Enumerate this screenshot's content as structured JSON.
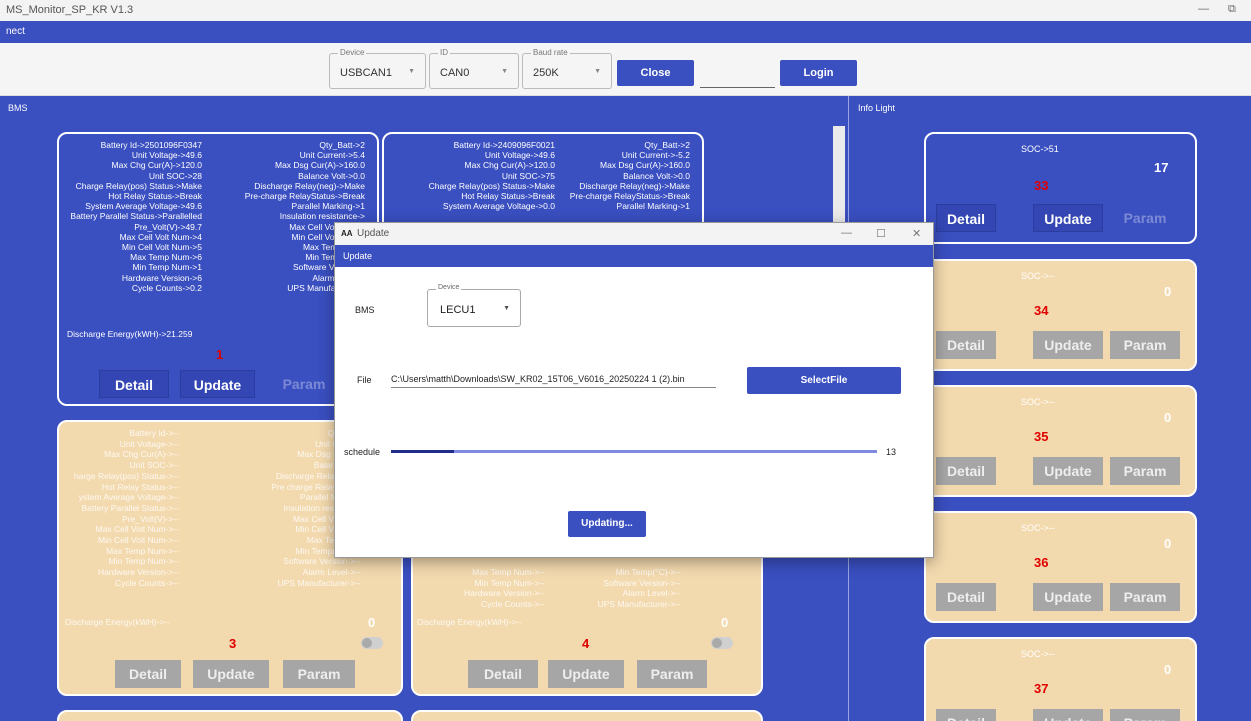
{
  "app": {
    "title": "MS_Monitor_SP_KR V1.3",
    "menu": "nect",
    "minimize_glyph": "—",
    "restore_glyph": "⧉"
  },
  "toolbar": {
    "device": {
      "label": "Device",
      "value": "USBCAN1"
    },
    "id": {
      "label": "ID",
      "value": "CAN0"
    },
    "baud": {
      "label": "Baud rate",
      "value": "250K"
    },
    "close_label": "Close",
    "login_label": "Login"
  },
  "sections": {
    "bms": "BMS",
    "info_light": "Info Light"
  },
  "card1": {
    "left": [
      "Battery Id->2501096F0347",
      "Unit Voltage->49.6",
      "Max Chg Cur(A)->120.0",
      "Unit SOC->28",
      "Charge Relay(pos) Status->Make",
      "Hot Relay Status->Break",
      "System Average Voltage->49.6",
      "Battery Parallel Status->Parallelled",
      "Pre_Volt(V)->49.7",
      "Max Cell Volt Num->4",
      "Min Cell Volt Num->5",
      "Max Temp Num->6",
      "Min Temp Num->1",
      "Hardware Version->6",
      "Cycle Counts->0.2",
      "Discharge Energy(kWH)->21.259"
    ],
    "right": [
      "Qty_Batt->2",
      "Unit Current->5.4",
      "Max Dsg Cur(A)->160.0",
      "Balance Volt->0.0",
      "Discharge Relay(neg)->Make",
      "Pre-charge RelayStatus->Break",
      "Parallel Marking->1",
      "Insulation resistance->",
      "Max Cell Volt(mV)->",
      "Min Cell Volt(mV)->",
      "Max Temp(°C)->",
      "Min Temp(°C)->",
      "Software Version->",
      "Alarm Level->",
      "UPS Manufacturer->"
    ],
    "num": "1",
    "detail": "Detail",
    "update": "Update",
    "param": "Param"
  },
  "card2": {
    "left": [
      "Battery Id->2409096F0021",
      "Unit Voltage->49.6",
      "Max Chg Cur(A)->120.0",
      "Unit SOC->75",
      "Charge Relay(pos) Status->Make",
      "Hot Relay Status->Break",
      "System Average Voltage->0.0"
    ],
    "right": [
      "Qty_Batt->2",
      "Unit Current->-5.2",
      "Max Dsg Cur(A)->160.0",
      "Balance Volt->0.0",
      "Discharge Relay(neg)->Make",
      "Pre-charge RelayStatus->Break",
      "Parallel Marking->1"
    ]
  },
  "card3": {
    "left": [
      "Battery Id->--",
      "Unit Voltage->--",
      "Max Chg Cur(A)->--",
      "Unit SOC->--",
      "harge Relay(pos) Status->--",
      "Hot Relay Status->--",
      "ystem Average Voltage->--",
      "Battery Parallel Status->--",
      "Pre_Volt(V)->--",
      "Max Cell Volt Num->--",
      "Min Cell Volt Num->--",
      "Max Temp Num->--",
      "Min Temp Num->--",
      "Hardware Version->--",
      "Cycle Counts->--",
      "Discharge Energy(kWH)->--"
    ],
    "right": [
      "Qty_Batt",
      "Unit Current",
      "Max Dsg Cur(A)-",
      "Balance Volt",
      "Discharge Relay(neg)-",
      "Pre charge RelayStatus",
      "Parallel Marking",
      "Insulation resistance",
      "Max Cell Volt(mV)",
      "Min Cell Volt(mV)",
      "Max Temp(°C)",
      "Min Temp(°C)->--",
      "Software Version->--",
      "Alarm Level->--",
      "UPS Manufacturer->--"
    ],
    "zero": "0",
    "num": "3",
    "detail": "Detail",
    "update": "Update",
    "param": "Param"
  },
  "card4": {
    "left": [
      "Max Temp Num->--",
      "Min Temp Num->--",
      "Hardware Version->--",
      "Cycle Counts->--",
      "Discharge Energy(kWH)->--"
    ],
    "right": [
      "Min Temp(°C)->--",
      "Software Version->--",
      "Alarm Level->--",
      "UPS Manufacturer->--"
    ],
    "zero": "0",
    "num": "4",
    "detail": "Detail",
    "update": "Update",
    "param": "Param"
  },
  "right_cards": [
    {
      "soc": "SOC->51",
      "big": "17",
      "num": "33",
      "detail": "Detail",
      "update": "Update",
      "param": "Param"
    },
    {
      "soc": "SOC->--",
      "big": "0",
      "num": "34",
      "detail": "Detail",
      "update": "Update",
      "param": "Param"
    },
    {
      "soc": "SOC->--",
      "big": "0",
      "num": "35",
      "detail": "Detail",
      "update": "Update",
      "param": "Param"
    },
    {
      "soc": "SOC->--",
      "big": "0",
      "num": "36",
      "detail": "Detail",
      "update": "Update",
      "param": "Param"
    },
    {
      "soc": "SOC->--",
      "big": "0",
      "num": "37",
      "detail": "Detail",
      "update": "Update",
      "param": "Param"
    }
  ],
  "dialog": {
    "logo": "AA",
    "title": "Update",
    "header": "Update",
    "bms_label": "BMS",
    "device_label": "Device",
    "device_value": "LECU1",
    "file_label": "File",
    "file_path": "C:\\Users\\matth\\Downloads\\SW_KR02_15T06_V6016_20250224 1 (2).bin",
    "select_file": "SelectFile",
    "schedule_label": "schedule",
    "progress_value": 13,
    "progress_text": "13",
    "updating_label": "Updating...",
    "minimize": "—",
    "maximize": "☐",
    "close": "✕"
  }
}
